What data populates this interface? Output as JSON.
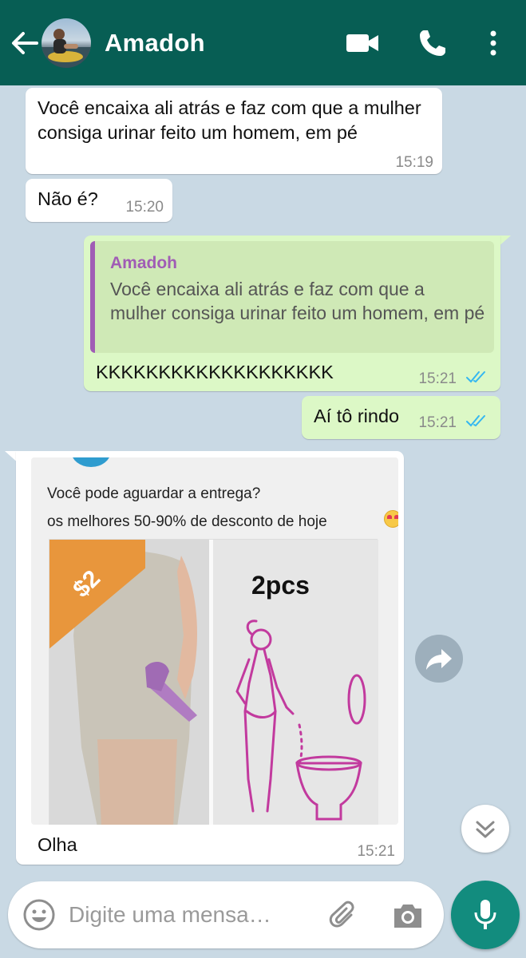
{
  "header": {
    "contact_name": "Amadoh",
    "icons": [
      "back-arrow-icon",
      "video-call-icon",
      "voice-call-icon",
      "more-options-icon"
    ],
    "color": "#075e54"
  },
  "messages": [
    {
      "direction": "incoming",
      "text": "Você encaixa ali atrás e faz com que a mulher consiga urinar feito um homem, em pé",
      "time": "15:19"
    },
    {
      "direction": "incoming",
      "text": "Não é?",
      "time": "15:20"
    },
    {
      "direction": "outgoing",
      "quote": {
        "author": "Amadoh",
        "text": "Você encaixa ali atrás e faz com que a mulher consiga urinar feito um homem, em pé"
      },
      "text": "KKKKKKKKKKKKKKKKKKK",
      "time": "15:21",
      "status": "read"
    },
    {
      "direction": "outgoing",
      "text": "Aí tô rindo",
      "time": "15:21",
      "status": "read"
    },
    {
      "direction": "incoming",
      "media": {
        "line1": "Você pode aguardar a entrega?",
        "line2": "os melhores 50-90% de desconto de hoje",
        "price_tag": "$2",
        "product_label": "2pcs"
      },
      "caption": "Olha",
      "time": "15:21"
    }
  ],
  "input": {
    "placeholder": "Digite uma mensa…"
  },
  "colors": {
    "incoming_bubble": "#ffffff",
    "outgoing_bubble": "#dcf8c6",
    "read_ticks": "#34b7f1",
    "accent": "#128c7e"
  }
}
